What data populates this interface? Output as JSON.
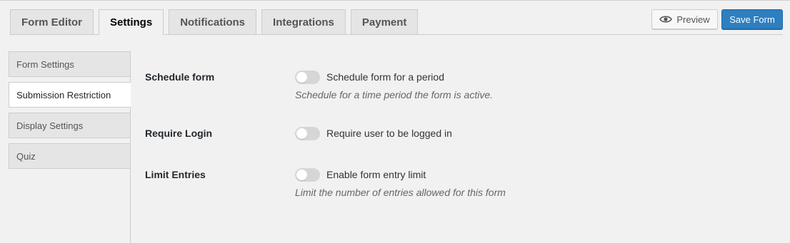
{
  "tabs": [
    {
      "label": "Form Editor",
      "active": false
    },
    {
      "label": "Settings",
      "active": true
    },
    {
      "label": "Notifications",
      "active": false
    },
    {
      "label": "Integrations",
      "active": false
    },
    {
      "label": "Payment",
      "active": false
    }
  ],
  "actions": {
    "preview_label": "Preview",
    "preview_icon": "eye-icon",
    "save_label": "Save Form",
    "save_color": "#2e7fc0"
  },
  "sidebar": {
    "items": [
      {
        "label": "Form Settings",
        "active": false
      },
      {
        "label": "Submission Restriction",
        "active": true
      },
      {
        "label": "Display Settings",
        "active": false
      },
      {
        "label": "Quiz",
        "active": false
      }
    ]
  },
  "settings": [
    {
      "label": "Schedule form",
      "toggle_label": "Schedule form for a period",
      "enabled": false,
      "help": "Schedule for a time period the form is active."
    },
    {
      "label": "Require Login",
      "toggle_label": "Require user to be logged in",
      "enabled": false,
      "help": ""
    },
    {
      "label": "Limit Entries",
      "toggle_label": "Enable form entry limit",
      "enabled": false,
      "help": "Limit the number of entries allowed for this form"
    }
  ]
}
